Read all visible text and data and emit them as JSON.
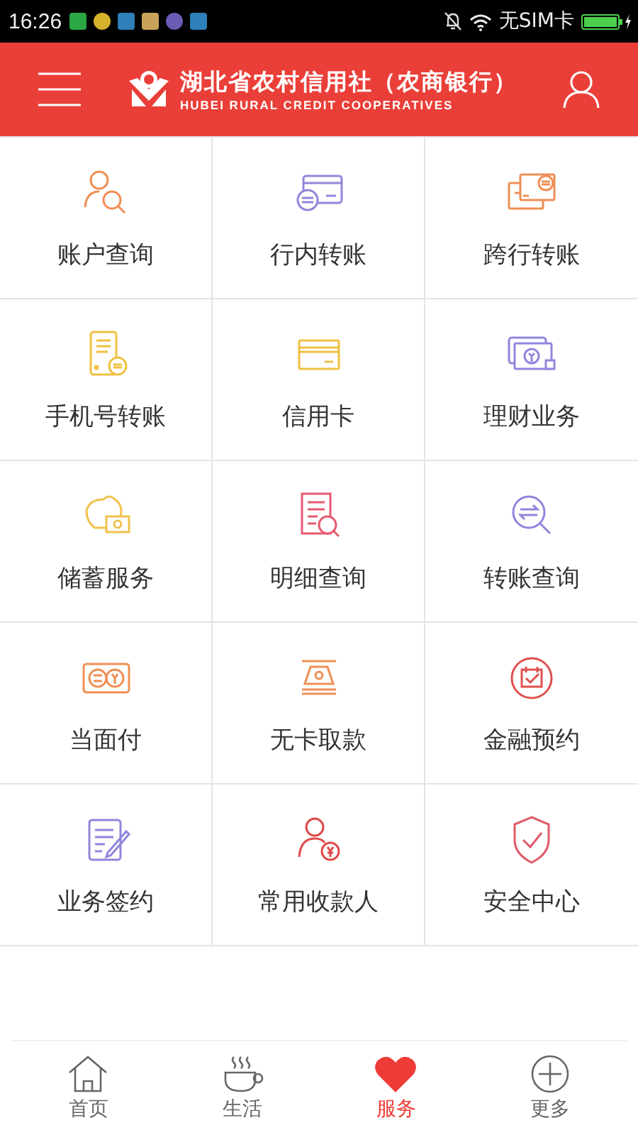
{
  "status_bar": {
    "time": "16:26",
    "carrier": "无SIM卡",
    "battery_charging": true
  },
  "header": {
    "title": "湖北省农村信用社（农商银行）",
    "subtitle": "HUBEI RURAL CREDIT COOPERATIVES"
  },
  "services": [
    {
      "label": "账户查询",
      "color": "#ef8f55"
    },
    {
      "label": "行内转账",
      "color": "#9286dc"
    },
    {
      "label": "跨行转账",
      "color": "#ef8f55"
    },
    {
      "label": "手机号转账",
      "color": "#f0c040"
    },
    {
      "label": "信用卡",
      "color": "#f0c040"
    },
    {
      "label": "理财业务",
      "color": "#8f86dd"
    },
    {
      "label": "储蓄服务",
      "color": "#f0c24e"
    },
    {
      "label": "明细查询",
      "color": "#e65a70"
    },
    {
      "label": "转账查询",
      "color": "#8f86dd"
    },
    {
      "label": "当面付",
      "color": "#ef8f55"
    },
    {
      "label": "无卡取款",
      "color": "#ef8f55"
    },
    {
      "label": "金融预约",
      "color": "#e05050"
    },
    {
      "label": "业务签约",
      "color": "#8f86dd"
    },
    {
      "label": "常用收款人",
      "color": "#e04848"
    },
    {
      "label": "安全中心",
      "color": "#e05a6a"
    }
  ],
  "tabs": [
    {
      "label": "首页",
      "selected": false
    },
    {
      "label": "生活",
      "selected": false
    },
    {
      "label": "服务",
      "selected": true
    },
    {
      "label": "更多",
      "selected": false
    }
  ]
}
